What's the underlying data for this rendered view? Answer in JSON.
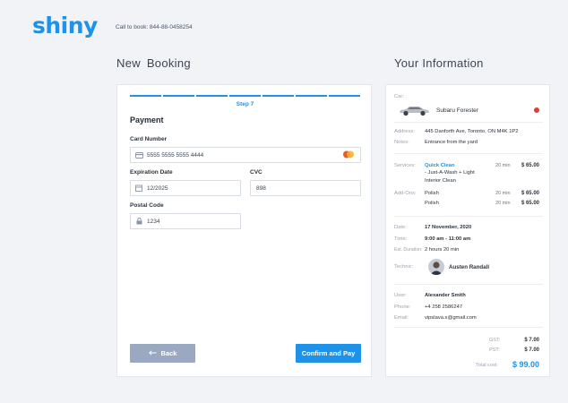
{
  "brand": {
    "logo": "shiny",
    "phone": "Call to book: 844-88-0458254"
  },
  "headings": {
    "left": "New Booking",
    "right": "Your Information"
  },
  "payment": {
    "step_label": "Step 7",
    "title": "Payment",
    "card_label": "Card Number",
    "card_value": "5555 5555 5555 4444",
    "exp_label": "Expiration Date",
    "exp_value": "12/2025",
    "cvc_label": "CVC",
    "cvc_value": "898",
    "postal_label": "Postal Code",
    "postal_value": "1234",
    "back_label": "Back",
    "pay_label": "Confirm and Pay"
  },
  "info": {
    "car_label": "Car:",
    "car_name": "Subaru Forester",
    "address_label": "Address:",
    "address": "445 Danforth Ave, Toronto, ON M4K 1P2",
    "notes_label": "Notes:",
    "notes": "Entrance from the yard",
    "services_label": "Services:",
    "service_name": "Quick Clean",
    "service_detail_1": "- Just-A-Wash + Light",
    "service_detail_2": "Interior Clean",
    "service_dur": "20 min",
    "service_price": "$ 65.00",
    "addons_label": "Add-Ons:",
    "addons": [
      {
        "name": "Polish",
        "dur": "20 min",
        "price": "$ 65.00"
      },
      {
        "name": "Polish",
        "dur": "20 min",
        "price": "$ 65.00"
      }
    ],
    "date_label": "Date:",
    "date": "17 November, 2020",
    "time_label": "Time:",
    "time": "9:00 am - 11:00 am",
    "duration_label": "Est. Duration:",
    "duration": "2 hours 20 min",
    "tech_label": "Technic:",
    "tech_name": "Austen Randall",
    "user_label": "User:",
    "user_name": "Alexander Smith",
    "phone_label": "Phone:",
    "phone": "+4 258 2586247",
    "email_label": "Email:",
    "email": "vipslava.s@gmail.com",
    "gst_label": "GST:",
    "gst": "$ 7.00",
    "pst_label": "PST:",
    "pst": "$ 7.00",
    "total_label": "Total cost:",
    "total": "$ 99.00"
  },
  "colors": {
    "accent": "#1d92e8",
    "back_button": "#9aa8c2",
    "background": "#f1f3f7",
    "car_dot": "#e53935"
  },
  "icons": [
    "credit-card-icon",
    "mastercard-icon",
    "calendar-icon",
    "lock-icon",
    "arrow-left-icon",
    "car-image",
    "avatar"
  ]
}
